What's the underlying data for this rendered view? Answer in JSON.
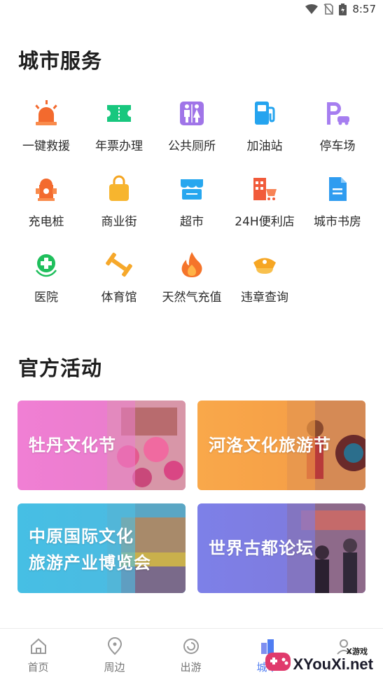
{
  "status": {
    "time": "8:57"
  },
  "sections": {
    "services_title": "城市服务",
    "activities_title": "官方活动"
  },
  "services": [
    [
      {
        "label": "一键救援",
        "icon": "siren-icon"
      },
      {
        "label": "年票办理",
        "icon": "ticket-icon"
      },
      {
        "label": "公共厕所",
        "icon": "restroom-icon"
      },
      {
        "label": "加油站",
        "icon": "fuel-pump-icon"
      },
      {
        "label": "停车场",
        "icon": "parking-icon"
      }
    ],
    [
      {
        "label": "充电桩",
        "icon": "hydrant-icon"
      },
      {
        "label": "商业街",
        "icon": "shopping-bag-icon"
      },
      {
        "label": "超市",
        "icon": "store-icon"
      },
      {
        "label": "24H便利店",
        "icon": "shop-cart-icon"
      },
      {
        "label": "城市书房",
        "icon": "document-icon"
      }
    ],
    [
      {
        "label": "医院",
        "icon": "medical-cross-icon"
      },
      {
        "label": "体育馆",
        "icon": "dumbbell-icon"
      },
      {
        "label": "天然气充值",
        "icon": "flame-icon"
      },
      {
        "label": "违章查询",
        "icon": "police-cap-icon"
      }
    ]
  ],
  "activities": [
    {
      "lines": [
        "牡丹文化节"
      ],
      "color": "#ee7fcf"
    },
    {
      "lines": [
        "河洛文化旅游节"
      ],
      "color": "#f8a04a"
    },
    {
      "lines": [
        "中原国际文化",
        "旅游产业博览会"
      ],
      "color": "#4cc2e6"
    },
    {
      "lines": [
        "世界古都论坛"
      ],
      "color": "#7b7de6"
    }
  ],
  "tabs": [
    {
      "label": "首页",
      "icon": "home-icon"
    },
    {
      "label": "周边",
      "icon": "location-pin-icon"
    },
    {
      "label": "出游",
      "icon": "swirl-icon"
    },
    {
      "label": "城市",
      "icon": "city-icon",
      "active": true
    },
    {
      "label": "",
      "icon": "profile-icon"
    }
  ],
  "watermark": {
    "small": "X游戏",
    "big": "XYouXi.net"
  }
}
